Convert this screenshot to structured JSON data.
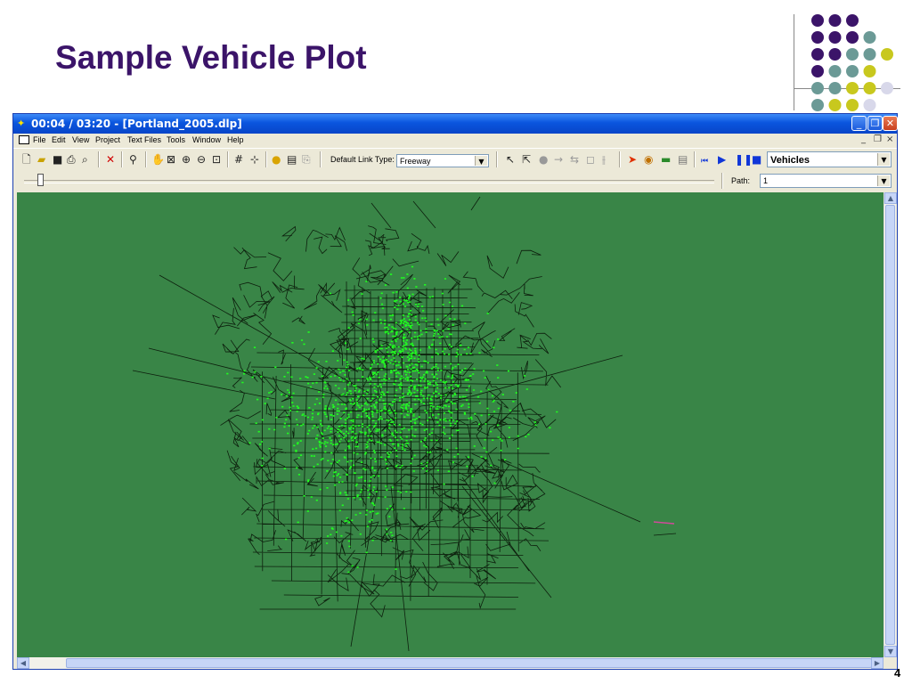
{
  "slide": {
    "title": "Sample Vehicle Plot",
    "page_number": "4",
    "dot_colors": {
      "purple": "#3b1469",
      "teal": "#6b9a96",
      "yellow": "#c8c81e",
      "lavender": "#d8d8ea"
    }
  },
  "window": {
    "title": "00:04 / 03:20 - [Portland_2005.dlp]",
    "buttons": {
      "minimize": "_",
      "restore": "❐",
      "close": "✕"
    }
  },
  "menu": {
    "items": [
      "File",
      "Edit",
      "View",
      "Project",
      "Text Files",
      "Tools",
      "Window",
      "Help"
    ],
    "mdi_controls": {
      "minimize": "_",
      "restore": "❐",
      "close": "×"
    }
  },
  "toolbar": {
    "default_link_type_label": "Default Link Type:",
    "default_link_type_value": "Freeway",
    "display_value": "Vehicles",
    "icons": [
      "new-icon",
      "open-icon",
      "save-icon",
      "print-icon",
      "print-preview-icon",
      "delete-icon",
      "node-icon",
      "pan-icon",
      "zoom-extents-icon",
      "zoom-in-icon",
      "zoom-out-icon",
      "fit-icon",
      "grid-icon",
      "snap-icon",
      "info-icon",
      "properties-icon",
      "copy-icon",
      "select-icon",
      "select-link-icon",
      "record-icon",
      "arrow-icon",
      "two-way-icon",
      "box-icon",
      "split-icon",
      "run-icon",
      "animate-icon",
      "map-icon",
      "report-icon",
      "rewind-icon",
      "play-icon",
      "pause-icon",
      "stop-icon"
    ]
  },
  "path": {
    "label": "Path:",
    "value": "1"
  },
  "map": {
    "background_color": "#398547",
    "network_color": "#0d1f0d",
    "vehicle_color": "#1fff1f"
  }
}
